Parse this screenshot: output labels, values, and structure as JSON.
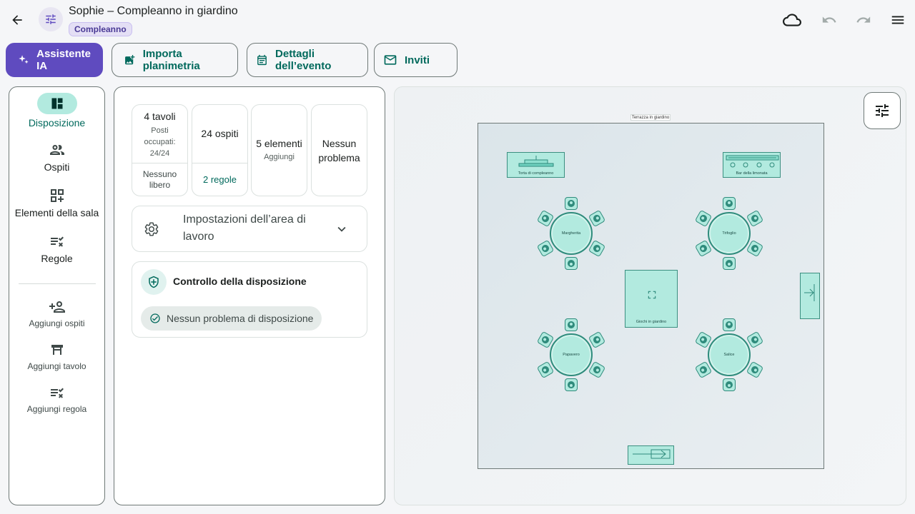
{
  "header": {
    "title": "Sophie – Compleanno in giardino",
    "chip": "Compleanno",
    "icons": [
      "arrow-back-icon",
      "tune-icon",
      "cloud-icon",
      "undo-icon",
      "redo-icon",
      "menu-icon"
    ]
  },
  "toolbar": {
    "ai": "Assistente IA",
    "import": "Importa planimetria",
    "details": "Dettagli dell’evento",
    "invites": "Inviti"
  },
  "nav": {
    "layout": "Disposizione",
    "guests": "Ospiti",
    "elements": "Elementi della sala",
    "rules": "Regole",
    "add_guests": "Aggiungi ospiti",
    "add_table": "Aggiungi tavolo",
    "add_rule": "Aggiungi regola"
  },
  "stats": {
    "tables": {
      "title": "4 tavoli",
      "sub": "Posti occupati: 24/24",
      "bottom": "Nessuno libero"
    },
    "guests": {
      "title": "24 ospiti",
      "bottom": "2 regole"
    },
    "elements": {
      "title": "5 elementi",
      "sub": "Aggiungi"
    },
    "issues": {
      "title": "Nessun problema"
    }
  },
  "settings": {
    "label": "Impostazioni dell’area di lavoro"
  },
  "control": {
    "title": "Controllo della disposizione",
    "status": "Nessun problema di disposizione"
  },
  "canvas": {
    "room_label": "Terrazza in giardino",
    "elements": {
      "cake": "Torta di compleanno",
      "bar": "Bar della limonata",
      "games": "Giochi in giardino"
    },
    "tables": [
      {
        "name": "Margherita",
        "seats": 6
      },
      {
        "name": "Trifoglio",
        "seats": 6
      },
      {
        "name": "Papavero",
        "seats": 6
      },
      {
        "name": "Salice",
        "seats": 6
      }
    ]
  },
  "colors": {
    "primary": "#00695c",
    "ai": "#5f4bbf",
    "table": "#b2eadf",
    "table_stroke": "#2f8b7c"
  }
}
